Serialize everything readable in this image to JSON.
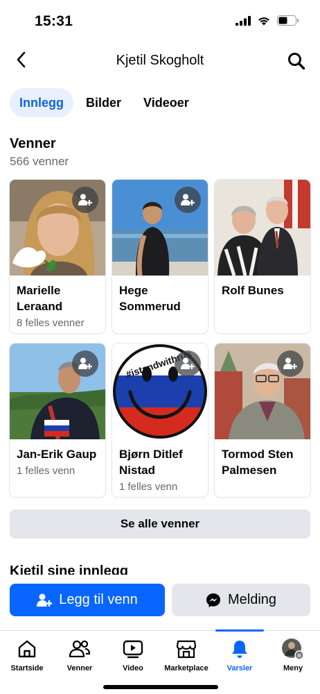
{
  "status_bar": {
    "time": "15:31"
  },
  "header": {
    "title": "Kjetil Skogholt"
  },
  "tabs": [
    {
      "label": "Innlegg",
      "active": true
    },
    {
      "label": "Bilder",
      "active": false
    },
    {
      "label": "Videoer",
      "active": false
    }
  ],
  "friends": {
    "title": "Venner",
    "count": "566 venner",
    "cards": [
      {
        "name": "Marielle Leraand",
        "mutual": "8 felles venner"
      },
      {
        "name": "Hege Sommerud",
        "mutual": ""
      },
      {
        "name": "Rolf Bunes",
        "mutual": ""
      },
      {
        "name": "Jan-Erik Gaup",
        "mutual": "1 felles venn"
      },
      {
        "name": "Bjørn Ditlef Nistad",
        "mutual": "1 felles venn"
      },
      {
        "name": "Tormod Sten Palmesen",
        "mutual": ""
      }
    ],
    "see_all": "Se alle venner",
    "photo_overlay_text": "#istandwithrus"
  },
  "posts": {
    "title": "Kjetil sine innlegg"
  },
  "actions": {
    "add_friend": "Legg til venn",
    "message": "Melding"
  },
  "nav": {
    "items": [
      {
        "label": "Startside",
        "icon": "home-icon"
      },
      {
        "label": "Venner",
        "icon": "friends-icon"
      },
      {
        "label": "Video",
        "icon": "video-icon"
      },
      {
        "label": "Marketplace",
        "icon": "marketplace-icon"
      },
      {
        "label": "Varsler",
        "icon": "bell-icon",
        "active": true
      },
      {
        "label": "Meny",
        "icon": "menu-avatar-icon"
      }
    ]
  },
  "colors": {
    "accent": "#0866ff",
    "tab_active_bg": "#e7f0fc",
    "tab_active_text": "#1064d4",
    "secondary_text": "#65676b"
  }
}
